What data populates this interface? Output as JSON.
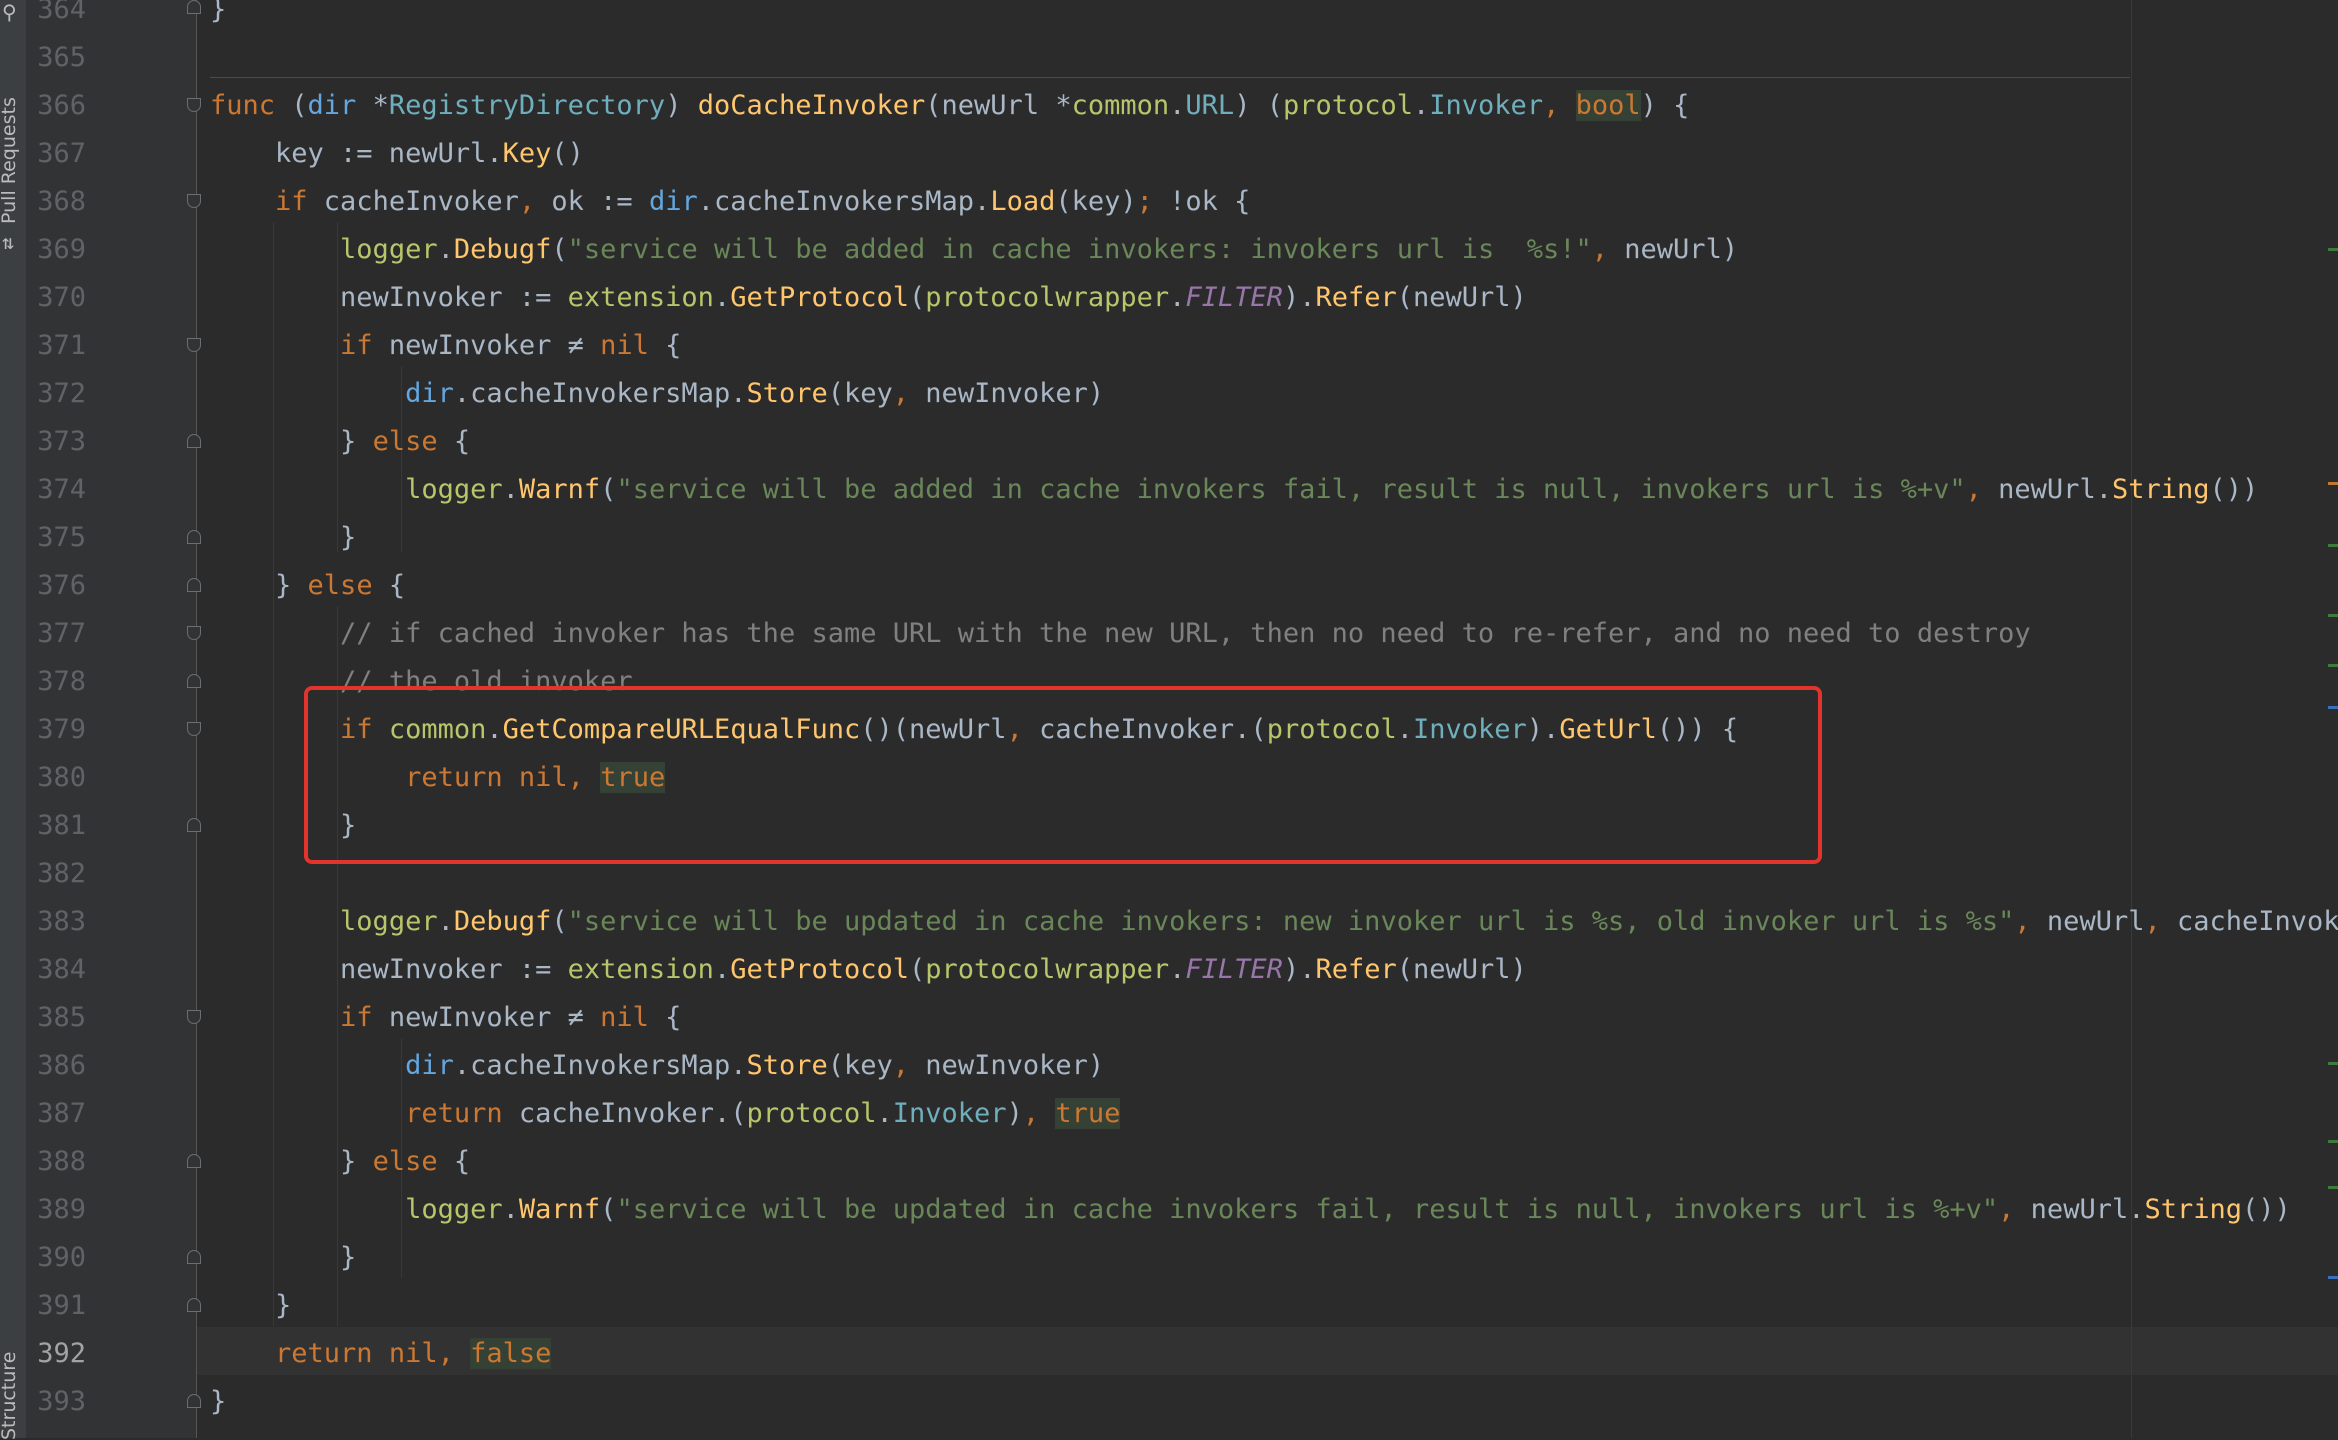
{
  "sidebar": {
    "pull_requests_label": "Pull Requests",
    "structure_label": "Structure"
  },
  "editor": {
    "current_line": "392",
    "lines": [
      {
        "n": "364",
        "t": "}"
      },
      {
        "n": "365",
        "t": ""
      },
      {
        "n": "366",
        "t": "func (dir *RegistryDirectory) doCacheInvoker(newUrl *common.URL) (protocol.Invoker, bool) {"
      },
      {
        "n": "367",
        "t": "    key := newUrl.Key()"
      },
      {
        "n": "368",
        "t": "    if cacheInvoker, ok := dir.cacheInvokersMap.Load(key); !ok {"
      },
      {
        "n": "369",
        "t": "        logger.Debugf(\"service will be added in cache invokers: invokers url is  %s!\", newUrl)"
      },
      {
        "n": "370",
        "t": "        newInvoker := extension.GetProtocol(protocolwrapper.FILTER).Refer(newUrl)"
      },
      {
        "n": "371",
        "t": "        if newInvoker ≠ nil {"
      },
      {
        "n": "372",
        "t": "            dir.cacheInvokersMap.Store(key, newInvoker)"
      },
      {
        "n": "373",
        "t": "        } else {"
      },
      {
        "n": "374",
        "t": "            logger.Warnf(\"service will be added in cache invokers fail, result is null, invokers url is %+v\", newUrl.String())"
      },
      {
        "n": "375",
        "t": "        }"
      },
      {
        "n": "376",
        "t": "    } else {"
      },
      {
        "n": "377",
        "t": "        // if cached invoker has the same URL with the new URL, then no need to re-refer, and no need to destroy"
      },
      {
        "n": "378",
        "t": "        // the old invoker."
      },
      {
        "n": "379",
        "t": "        if common.GetCompareURLEqualFunc()(newUrl, cacheInvoker.(protocol.Invoker).GetUrl()) {"
      },
      {
        "n": "380",
        "t": "            return nil, true"
      },
      {
        "n": "381",
        "t": "        }"
      },
      {
        "n": "382",
        "t": ""
      },
      {
        "n": "383",
        "t": "        logger.Debugf(\"service will be updated in cache invokers: new invoker url is %s, old invoker url is %s\", newUrl, cacheInvoker"
      },
      {
        "n": "384",
        "t": "        newInvoker := extension.GetProtocol(protocolwrapper.FILTER).Refer(newUrl)"
      },
      {
        "n": "385",
        "t": "        if newInvoker ≠ nil {"
      },
      {
        "n": "386",
        "t": "            dir.cacheInvokersMap.Store(key, newInvoker)"
      },
      {
        "n": "387",
        "t": "            return cacheInvoker.(protocol.Invoker), true"
      },
      {
        "n": "388",
        "t": "        } else {"
      },
      {
        "n": "389",
        "t": "            logger.Warnf(\"service will be updated in cache invokers fail, result is null, invokers url is %+v\", newUrl.String())"
      },
      {
        "n": "390",
        "t": "        }"
      },
      {
        "n": "391",
        "t": "    }"
      },
      {
        "n": "392",
        "t": "    return nil, false"
      },
      {
        "n": "393",
        "t": "}"
      }
    ]
  },
  "colors": {
    "background": "#2b2b2b",
    "keyword": "#cc7832",
    "function": "#ffc66d",
    "string": "#6a8759",
    "comment": "#808080",
    "type": "#6fafbd",
    "highlight_box": "#e2332d"
  }
}
